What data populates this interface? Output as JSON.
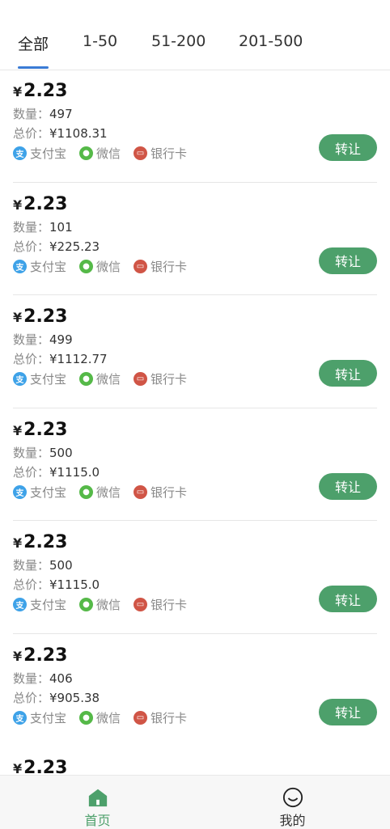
{
  "tabs": [
    {
      "label": "全部",
      "active": true
    },
    {
      "label": "1-50",
      "active": false
    },
    {
      "label": "51-200",
      "active": false
    },
    {
      "label": "201-500",
      "active": false
    }
  ],
  "currency": "¥",
  "labels": {
    "quantity": "数量：",
    "total": "总价：",
    "pay_alipay": "支付宝",
    "pay_wechat": "微信",
    "pay_card": "银行卡",
    "transfer": "转让"
  },
  "icons": {
    "alipay": "alipay-icon",
    "wechat": "wechat-icon",
    "card": "bank-card-icon",
    "home": "home-icon",
    "mine": "smiley-icon"
  },
  "items": [
    {
      "price": "2.23",
      "quantity": "497",
      "total": "¥1108.31"
    },
    {
      "price": "2.23",
      "quantity": "101",
      "total": "¥225.23"
    },
    {
      "price": "2.23",
      "quantity": "499",
      "total": "¥1112.77"
    },
    {
      "price": "2.23",
      "quantity": "500",
      "total": "¥1115.0"
    },
    {
      "price": "2.23",
      "quantity": "500",
      "total": "¥1115.0"
    },
    {
      "price": "2.23",
      "quantity": "406",
      "total": "¥905.38"
    },
    {
      "price": "2.23"
    }
  ],
  "nav": [
    {
      "label": "首页",
      "active": true
    },
    {
      "label": "我的",
      "active": false
    }
  ],
  "colors": {
    "accent": "#4da06b",
    "tab_underline": "#3a7bd5",
    "alipay": "#3ea2e8",
    "wechat": "#55b948",
    "card": "#d05546"
  }
}
